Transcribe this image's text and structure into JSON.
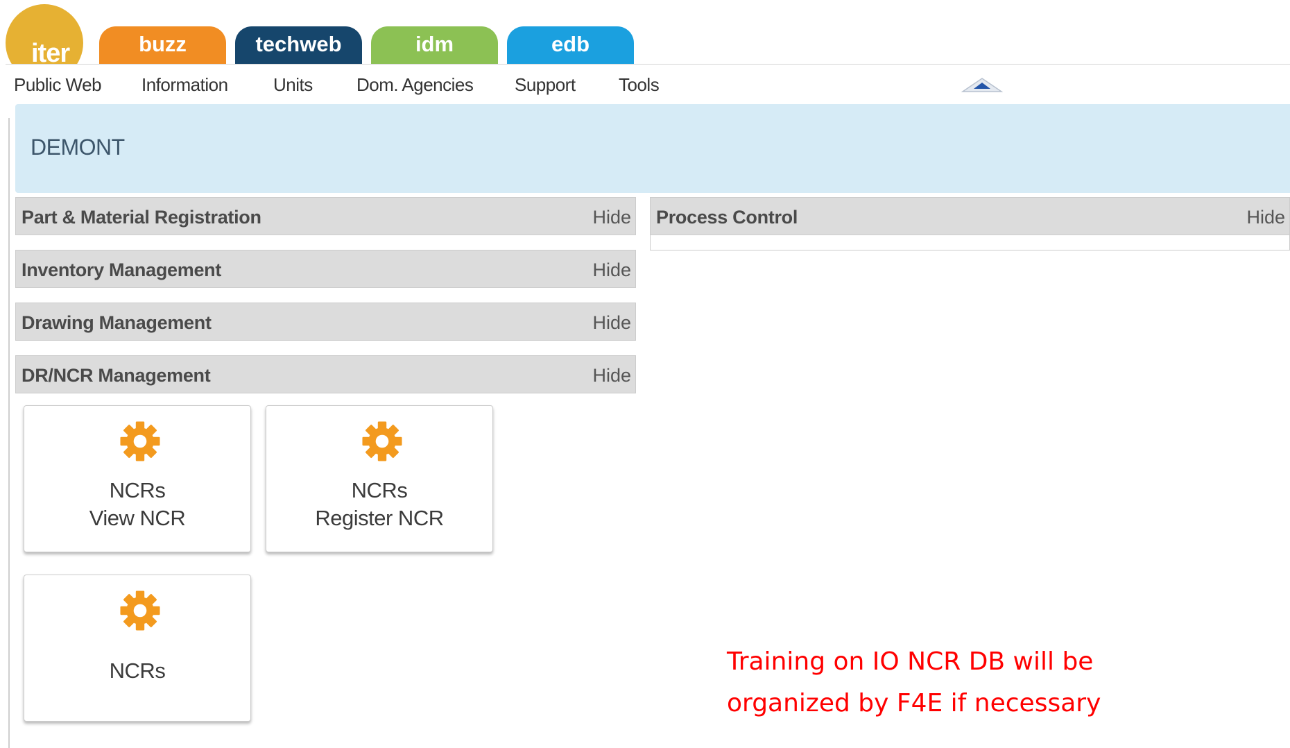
{
  "tabs": {
    "logo": "iter",
    "items": [
      {
        "label": "buzz",
        "color": "#f18d23"
      },
      {
        "label": "techweb",
        "color": "#16466c"
      },
      {
        "label": "idm",
        "color": "#8cc154"
      },
      {
        "label": "edb",
        "color": "#1ba0df"
      }
    ]
  },
  "nav": {
    "items": [
      "Public Web",
      "Information",
      "Units",
      "Dom. Agencies",
      "Support",
      "Tools"
    ],
    "collapse_icon": "triangle-up-icon"
  },
  "banner": {
    "title": "DEMONT"
  },
  "sections": {
    "left": [
      {
        "title": "Part & Material Registration",
        "hide_label": "Hide"
      },
      {
        "title": "Inventory Management",
        "hide_label": "Hide"
      },
      {
        "title": "Drawing Management",
        "hide_label": "Hide"
      },
      {
        "title": "DR/NCR Management",
        "hide_label": "Hide"
      }
    ],
    "right": [
      {
        "title": "Process Control",
        "hide_label": "Hide"
      }
    ]
  },
  "tiles": [
    {
      "icon": "gear-icon",
      "line1": "NCRs",
      "line2": "View NCR"
    },
    {
      "icon": "gear-icon",
      "line1": "NCRs",
      "line2": "Register NCR"
    },
    {
      "icon": "gear-icon",
      "line1": "NCRs",
      "line2": ""
    }
  ],
  "note": {
    "line1": "Training on IO NCR DB will be",
    "line2": "organized by F4E if necessary",
    "color": "#ff0000"
  },
  "colors": {
    "banner_bg": "#d6ebf6",
    "section_bg": "#dcdcdc",
    "gear": "#f39a1e"
  }
}
